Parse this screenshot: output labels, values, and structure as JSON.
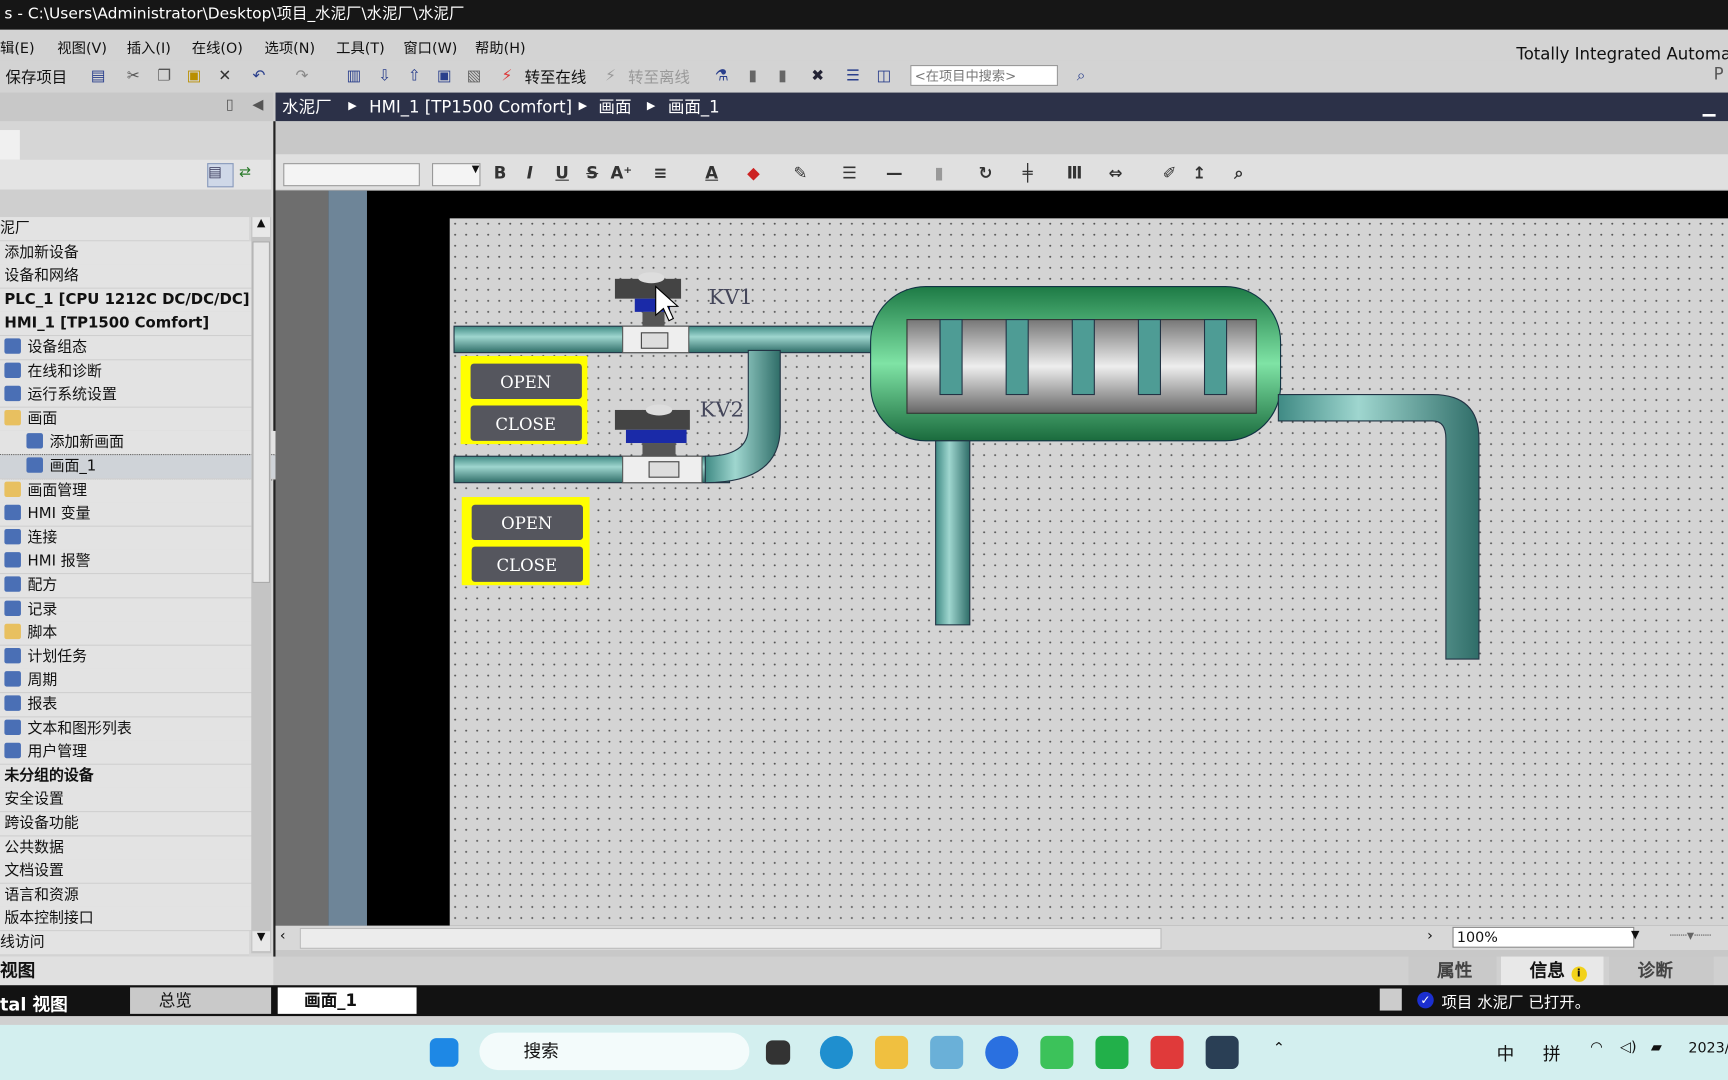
{
  "window": {
    "title": "s  -  C:\\Users\\Administrator\\Desktop\\项目_水泥厂\\水泥厂\\水泥厂"
  },
  "menu": [
    "辑(E)",
    "视图(V)",
    "插入(I)",
    "在线(O)",
    "选项(N)",
    "工具(T)",
    "窗口(W)",
    "帮助(H)"
  ],
  "toolbar": {
    "save_label": "保存项目",
    "go_online": "转至在线",
    "go_offline": "转至离线",
    "search_placeholder": "<在项目中搜索>"
  },
  "brand": {
    "line1": "Totally Integrated Automa",
    "line2": "P"
  },
  "breadcrumb": [
    "水泥厂",
    "HMI_1 [TP1500 Comfort]",
    "画面",
    "画面_1"
  ],
  "tree": [
    {
      "label": "泥厂",
      "level": 0
    },
    {
      "label": "添加新设备",
      "level": 1
    },
    {
      "label": "设备和网络",
      "level": 1
    },
    {
      "label": "PLC_1 [CPU 1212C DC/DC/DC]",
      "level": 1,
      "bold": true
    },
    {
      "label": "HMI_1 [TP1500 Comfort]",
      "level": 1,
      "bold": true
    },
    {
      "label": "设备组态",
      "level": 2,
      "icon": "device-config-icon"
    },
    {
      "label": "在线和诊断",
      "level": 2,
      "icon": "diagnostics-icon"
    },
    {
      "label": "运行系统设置",
      "level": 2,
      "icon": "runtime-settings-icon"
    },
    {
      "label": "画面",
      "level": 2,
      "icon": "folder-icon"
    },
    {
      "label": "添加新画面",
      "level": 3,
      "icon": "add-screen-icon"
    },
    {
      "label": "画面_1",
      "level": 3,
      "icon": "screen-icon",
      "selected": true
    },
    {
      "label": "画面管理",
      "level": 2,
      "icon": "folder-icon"
    },
    {
      "label": "HMI 变量",
      "level": 2,
      "icon": "tags-icon"
    },
    {
      "label": "连接",
      "level": 2,
      "icon": "connection-icon"
    },
    {
      "label": "HMI 报警",
      "level": 2,
      "icon": "alarm-icon"
    },
    {
      "label": "配方",
      "level": 2,
      "icon": "recipe-icon"
    },
    {
      "label": "记录",
      "level": 2,
      "icon": "log-icon"
    },
    {
      "label": "脚本",
      "level": 2,
      "icon": "folder-icon"
    },
    {
      "label": "计划任务",
      "level": 2,
      "icon": "scheduler-icon"
    },
    {
      "label": "周期",
      "level": 2,
      "icon": "cycle-icon"
    },
    {
      "label": "报表",
      "level": 2,
      "icon": "report-icon"
    },
    {
      "label": "文本和图形列表",
      "level": 2,
      "icon": "text-list-icon"
    },
    {
      "label": "用户管理",
      "level": 2,
      "icon": "users-icon"
    },
    {
      "label": "未分组的设备",
      "level": 1,
      "bold": true
    },
    {
      "label": "安全设置",
      "level": 1
    },
    {
      "label": "跨设备功能",
      "level": 1
    },
    {
      "label": "公共数据",
      "level": 1
    },
    {
      "label": "文档设置",
      "level": 1
    },
    {
      "label": "语言和资源",
      "level": 1
    },
    {
      "label": "版本控制接口",
      "level": 1
    },
    {
      "label": "线访问",
      "level": 0
    }
  ],
  "left_bottom": {
    "detail_view": "视图",
    "portal_view": "tal 视图",
    "overview_tab": "总览",
    "screen_tab": "画面_1"
  },
  "hmi": {
    "kv1": "KV1",
    "kv2": "KV2",
    "open": "OPEN",
    "close": "CLOSE"
  },
  "zoom": "100%",
  "inspector_tabs": [
    "属性",
    "信息",
    "诊断"
  ],
  "status": "项目 水泥厂 已打开。",
  "taskbar": {
    "search": "搜索",
    "tray": [
      "中",
      "拼"
    ],
    "date": "2023/"
  },
  "colors": {
    "pipe": "#5fa8a0",
    "tank": "#2ea860",
    "button_frame": "#ffff00",
    "button": "#55565e",
    "breadcrumb_bg": "#2c3148"
  }
}
